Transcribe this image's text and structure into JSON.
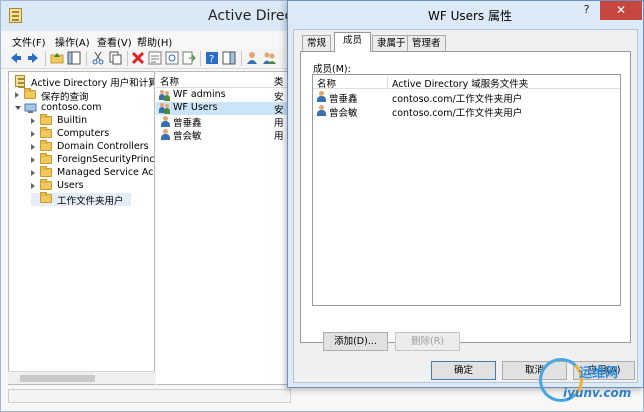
{
  "main_window": {
    "title": "Active Directory",
    "menu": {
      "file": "文件(F)",
      "action": "操作(A)",
      "view": "查看(V)",
      "help": "帮助(H)"
    },
    "tree": {
      "root": "Active Directory 用户和计算机",
      "saved_queries": "保存的查询",
      "domain": "contoso.com",
      "children": [
        "Builtin",
        "Computers",
        "Domain Controllers",
        "ForeignSecurityPrincipa",
        "Managed Service Acco",
        "Users",
        "工作文件夹用户"
      ]
    },
    "list": {
      "col_name": "名称",
      "col_type": "类",
      "rows": [
        {
          "name": "WF admins",
          "type": "安",
          "icon": "group-icon"
        },
        {
          "name": "WF Users",
          "type": "安",
          "icon": "group-icon"
        },
        {
          "name": "曾垂鑫",
          "type": "用",
          "icon": "user-icon"
        },
        {
          "name": "曾会敏",
          "type": "用",
          "icon": "user-icon"
        }
      ]
    }
  },
  "dialog": {
    "title": "WF Users 属性",
    "help": "?",
    "close": "✕",
    "tabs": [
      "常规",
      "成员",
      "隶属于",
      "管理者"
    ],
    "members_label": "成员(M):",
    "columns": [
      "名称",
      "Active Directory 域服务文件夹"
    ],
    "members": [
      {
        "name": "曾垂鑫",
        "folder": "contoso.com/工作文件夹用户"
      },
      {
        "name": "曾会敏",
        "folder": "contoso.com/工作文件夹用户"
      }
    ],
    "buttons": {
      "add": "添加(D)...",
      "remove": "删除(R)",
      "ok": "确定",
      "cancel": "取消",
      "apply": "应用(A)"
    }
  },
  "watermark": {
    "top": "运维网",
    "bottom": "iyunv.com"
  },
  "colors": {
    "titlebar": "#dce9f6",
    "close_button": "#c7463f",
    "selection": "#cce4f7"
  }
}
